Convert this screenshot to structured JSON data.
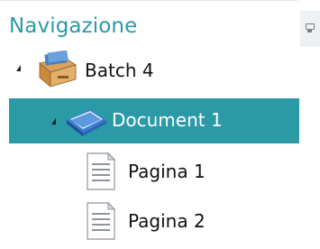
{
  "panel": {
    "title": "Navigazione"
  },
  "tree": {
    "batch": {
      "label": "Batch 4",
      "icon": "archive-box-icon",
      "expanded": true
    },
    "document": {
      "label": "Document 1",
      "icon": "document-book-icon",
      "expanded": true,
      "selected": true
    },
    "pages": [
      {
        "label": "Pagina 1",
        "icon": "page-icon"
      },
      {
        "label": "Pagina 2",
        "icon": "page-icon"
      }
    ]
  },
  "colors": {
    "accent": "#2a9aa7",
    "selected_text": "#ffffff"
  }
}
